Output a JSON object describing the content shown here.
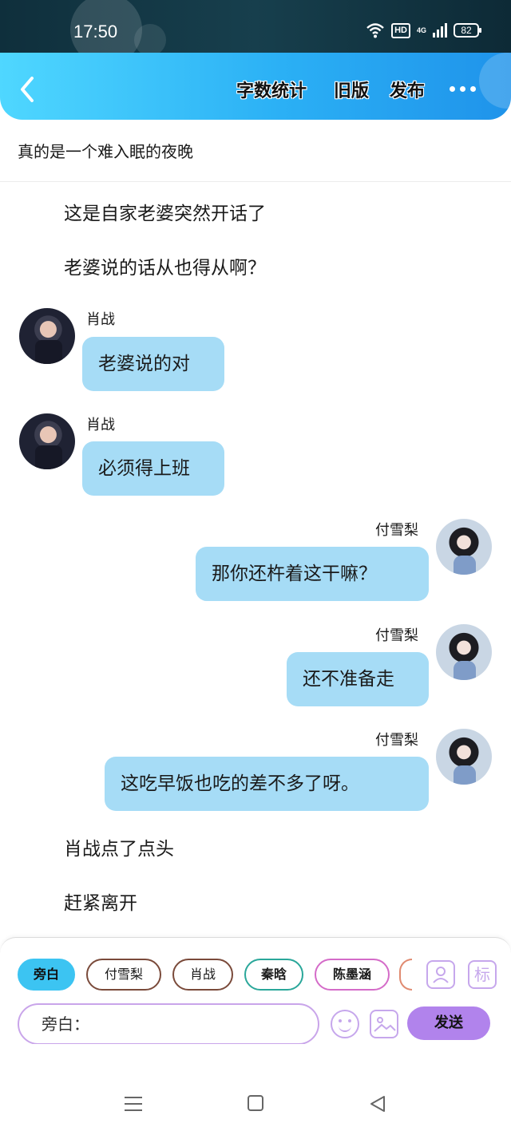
{
  "status_bar": {
    "time": "17:50",
    "hd_label": "HD",
    "network_label": "4G",
    "battery": "82"
  },
  "header": {
    "word_count_label": "字数统计",
    "old_version_label": "旧版",
    "publish_label": "发布"
  },
  "chapter": {
    "title": "真的是一个难入眠的夜晚"
  },
  "messages": [
    {
      "type": "narration",
      "text": "这是自家老婆突然开话了"
    },
    {
      "type": "narration",
      "text": "老婆说的话从也得从啊？"
    },
    {
      "type": "left",
      "speaker": "肖战",
      "text": "老婆说的对"
    },
    {
      "type": "left",
      "speaker": "肖战",
      "text": "必须得上班"
    },
    {
      "type": "right",
      "speaker": "付雪梨",
      "text": "那你还杵着这干嘛？"
    },
    {
      "type": "right",
      "speaker": "付雪梨",
      "text": "还不准备走"
    },
    {
      "type": "right",
      "speaker": "付雪梨",
      "text": "这吃早饭也吃的差不多了呀。"
    },
    {
      "type": "narration",
      "text": "肖战点了点头"
    },
    {
      "type": "narration",
      "text": "赶紧离开"
    }
  ],
  "roles": [
    "旁白",
    "付雪梨",
    "肖战",
    "秦晗",
    "陈墨涵"
  ],
  "toolbar": {
    "tag_icon_label": "标"
  },
  "composer": {
    "input_value": "旁白：",
    "send_label": "发送"
  },
  "icons": {
    "back": "chevron-left-icon",
    "more": "more-dots-icon",
    "role": "person-card-icon",
    "emoji": "smiley-icon",
    "image": "image-icon"
  },
  "colors": {
    "header_start": "#4fd7ff",
    "header_end": "#1f93ea",
    "bubble": "#a6dcf6",
    "send": "#b183ec",
    "active_chip": "#3cc4f2"
  }
}
